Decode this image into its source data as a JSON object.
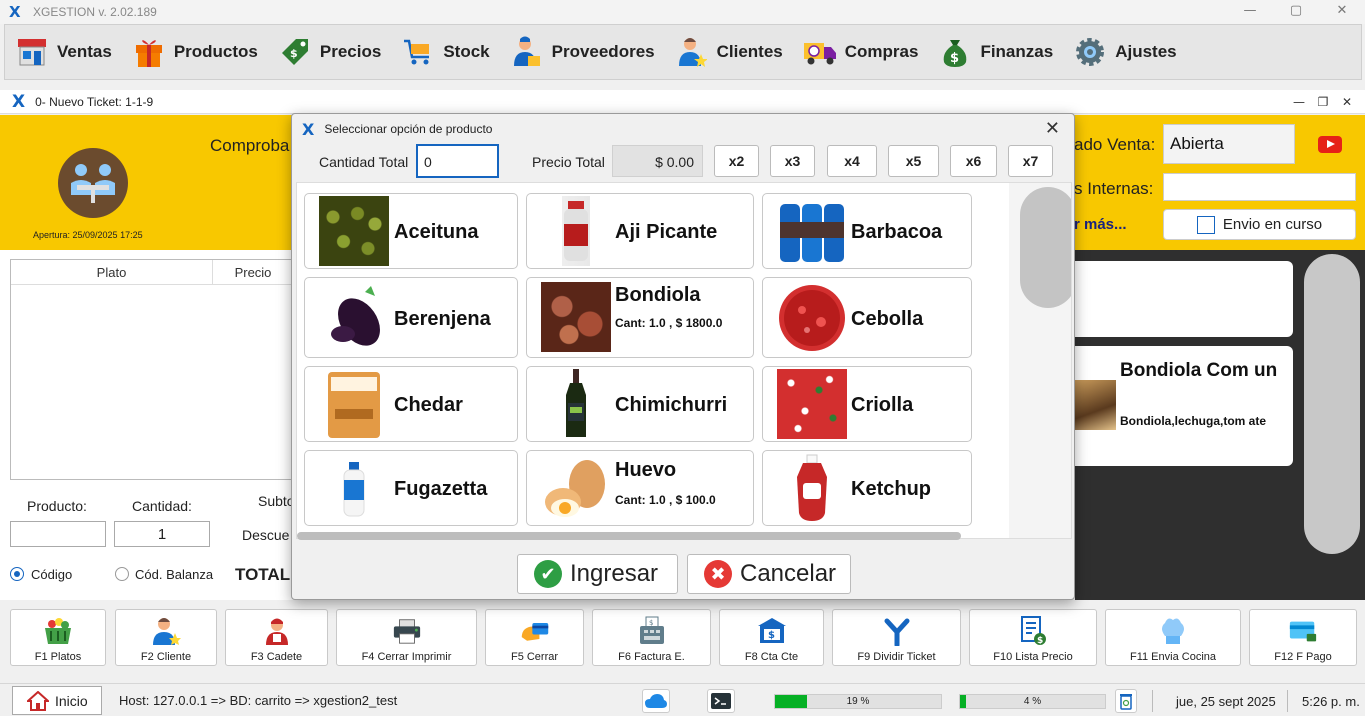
{
  "app": {
    "title": "XGESTION v. 2.02.189",
    "logo": "X",
    "window_controls": [
      "—",
      "▢",
      "✕"
    ]
  },
  "menu": [
    {
      "label": "Ventas",
      "icon": "store-icon"
    },
    {
      "label": "Productos",
      "icon": "gift-box-icon"
    },
    {
      "label": "Precios",
      "icon": "price-tag-icon"
    },
    {
      "label": "Stock",
      "icon": "cart-icon"
    },
    {
      "label": "Proveedores",
      "icon": "supplier-icon"
    },
    {
      "label": "Clientes",
      "icon": "client-icon"
    },
    {
      "label": "Compras",
      "icon": "truck-icon"
    },
    {
      "label": "Finanzas",
      "icon": "money-bag-icon"
    },
    {
      "label": "Ajustes",
      "icon": "gear-icon"
    }
  ],
  "ticket": {
    "title": "0-  Nuevo Ticket: 1-1-9",
    "controls": [
      "—",
      "❐",
      "✕"
    ],
    "apertura": "Apertura: 25/09/2025 17:25",
    "comproba": "Comproba",
    "estado_label": "ado Venta:",
    "estado_value": "Abierta",
    "internas_label": "s Internas:",
    "ver_mas": "r más...",
    "envio": "Envio en curso",
    "table_headers": [
      "Plato",
      "Precio"
    ],
    "producto_label": "Producto:",
    "cantidad_label": "Cantidad:",
    "cantidad_value": "1",
    "subtotal_label": "Subto",
    "descuento_label": "Descue",
    "radio_codigo": "Código",
    "radio_balanza": "Cód. Balanza",
    "total_label": "TOTAL",
    "right_card": {
      "name": "Bondiola Com un",
      "desc": "Bondiola,lechuga,tom ate"
    }
  },
  "modal": {
    "logo": "X",
    "title": "Seleccionar opción de producto",
    "close": "✕",
    "cantidad_label": "Cantidad Total",
    "cantidad_value": "0",
    "precio_label": "Precio Total",
    "precio_value": "$ 0.00",
    "multipliers": [
      "x2",
      "x3",
      "x4",
      "x5",
      "x6",
      "x7"
    ],
    "products": [
      {
        "name": "Aceituna",
        "info": ""
      },
      {
        "name": "Aji Picante",
        "info": ""
      },
      {
        "name": "Barbacoa",
        "info": ""
      },
      {
        "name": "Berenjena",
        "info": ""
      },
      {
        "name": "Bondiola",
        "info": "Cant: 1.0 , $ 1800.0"
      },
      {
        "name": "Cebolla",
        "info": ""
      },
      {
        "name": "Chedar",
        "info": ""
      },
      {
        "name": "Chimichurri",
        "info": ""
      },
      {
        "name": "Criolla",
        "info": ""
      },
      {
        "name": "Fugazetta",
        "info": ""
      },
      {
        "name": "Huevo",
        "info": "Cant: 1.0 , $ 100.0"
      },
      {
        "name": "Ketchup",
        "info": ""
      }
    ],
    "ok_label": "Ingresar",
    "ok_icon": "✔",
    "cancel_label": "Cancelar",
    "cancel_icon": "✖"
  },
  "fkeys": [
    {
      "label": "F1 Platos",
      "icon": "basket-icon"
    },
    {
      "label": "F2 Cliente",
      "icon": "client-icon"
    },
    {
      "label": "F3 Cadete",
      "icon": "courier-icon"
    },
    {
      "label": "F4 Cerrar Imprimir",
      "icon": "printer-icon"
    },
    {
      "label": "F5 Cerrar",
      "icon": "card-icon"
    },
    {
      "label": "F6 Factura E.",
      "icon": "invoice-machine-icon"
    },
    {
      "label": "F8 Cta Cte",
      "icon": "bank-icon"
    },
    {
      "label": "F9 Dividir Ticket",
      "icon": "split-icon"
    },
    {
      "label": "F10 Lista Precio",
      "icon": "price-list-icon"
    },
    {
      "label": "F11 Envia Cocina",
      "icon": "chef-hat-icon"
    },
    {
      "label": "F12 F Pago",
      "icon": "payment-card-icon"
    }
  ],
  "status": {
    "inicio": "Inicio",
    "host": "Host: 127.0.0.1 => BD: carrito => xgestion2_test",
    "progress1_text": "19 %",
    "progress1_value": 0.19,
    "progress2_text": "4 %",
    "progress2_value": 0.04,
    "date": "jue, 25 sept 2025",
    "time": "5:26 p. m."
  }
}
